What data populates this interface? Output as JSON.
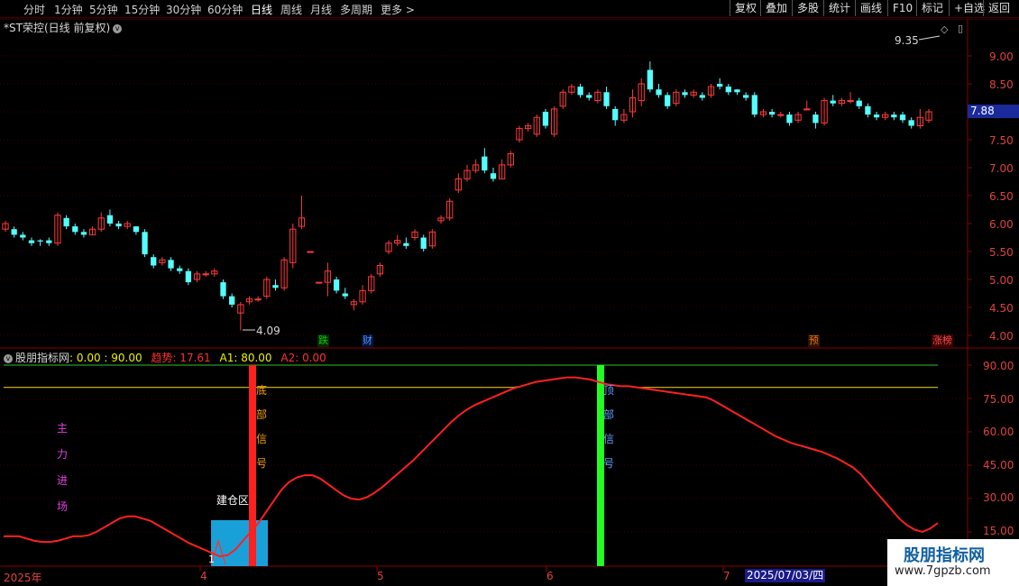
{
  "toolbar": {
    "periods": [
      "分时",
      "1分钟",
      "5分钟",
      "15分钟",
      "30分钟",
      "60分钟",
      "日线",
      "周线",
      "月线",
      "多周期",
      "更多 >"
    ],
    "active_period": "日线",
    "right_buttons": [
      "复权",
      "叠加",
      "多股",
      "统计",
      "画线",
      "F10",
      "标记",
      "+自选",
      "返回"
    ]
  },
  "main_chart": {
    "title": "*ST荣控(日线 前复权)",
    "title_circle": "v",
    "current_price": "7.88",
    "high_label": "9.35",
    "low_label": "4.09",
    "badges": [
      {
        "text": "跌",
        "color": "#00c000"
      },
      {
        "text": "财",
        "color": "#3a7aff"
      },
      {
        "text": "预",
        "color": "#e06000"
      },
      {
        "text": "涨榜",
        "color": "#e03030"
      }
    ],
    "y_ticks": [
      "9.00",
      "8.50",
      "8.00",
      "7.50",
      "7.00",
      "6.50",
      "6.00",
      "5.50",
      "5.00",
      "4.50",
      "4.00"
    ]
  },
  "indicator": {
    "name": "股朋指标网",
    "label_range": ": 0.00 : 90.00",
    "trend_label": "趋势: 17.61",
    "a1_label": "A1: 80.00",
    "a2_label": "A2: 0.00",
    "y_ticks": [
      "90.00",
      "75.00",
      "60.00",
      "45.00",
      "30.00",
      "15.00"
    ],
    "bottom_signal_text": [
      "底",
      "部",
      "信",
      "号"
    ],
    "top_signal_text": [
      "顶",
      "部",
      "信",
      "号"
    ],
    "main_force_text": [
      "主",
      "力",
      "进",
      "场"
    ],
    "build_zone_text": "建仓区",
    "marker_1": "1"
  },
  "x_axis": {
    "labels": [
      "2025年",
      "4",
      "5",
      "6",
      "7"
    ],
    "cursor_date": "2025/07/03/四"
  },
  "watermark": {
    "title": "股朋指标网",
    "url": "www.7gpzb.com"
  },
  "chart_data": {
    "type": "candlestick",
    "title": "*ST荣控(日线 前复权)",
    "ylim": [
      4.0,
      9.2
    ],
    "candles": [
      [
        5.9,
        6.0,
        5.85,
        6.05
      ],
      [
        5.9,
        5.8,
        5.75,
        5.95
      ],
      [
        5.8,
        5.75,
        5.7,
        5.85
      ],
      [
        5.7,
        5.65,
        5.6,
        5.75
      ],
      [
        5.7,
        5.68,
        5.6,
        5.72
      ],
      [
        5.7,
        5.65,
        5.6,
        5.75
      ],
      [
        5.65,
        6.15,
        5.6,
        6.2
      ],
      [
        6.1,
        5.95,
        5.9,
        6.15
      ],
      [
        5.95,
        5.85,
        5.8,
        6.0
      ],
      [
        5.85,
        5.8,
        5.75,
        5.9
      ],
      [
        5.8,
        5.9,
        5.8,
        5.95
      ],
      [
        5.9,
        6.1,
        5.85,
        6.2
      ],
      [
        6.15,
        6.0,
        5.95,
        6.25
      ],
      [
        6.0,
        5.95,
        5.9,
        6.05
      ],
      [
        5.95,
        6.0,
        5.9,
        6.05
      ],
      [
        5.95,
        5.85,
        5.8,
        5.95
      ],
      [
        5.85,
        5.45,
        5.4,
        5.9
      ],
      [
        5.4,
        5.25,
        5.2,
        5.45
      ],
      [
        5.3,
        5.35,
        5.25,
        5.4
      ],
      [
        5.35,
        5.2,
        5.15,
        5.4
      ],
      [
        5.2,
        5.15,
        5.1,
        5.25
      ],
      [
        5.15,
        4.95,
        4.9,
        5.2
      ],
      [
        5.0,
        5.1,
        4.95,
        5.15
      ],
      [
        5.1,
        5.1,
        5.05,
        5.15
      ],
      [
        5.1,
        5.15,
        5.05,
        5.2
      ],
      [
        4.95,
        4.7,
        4.65,
        5.0
      ],
      [
        4.7,
        4.55,
        4.5,
        4.75
      ],
      [
        4.4,
        4.55,
        4.09,
        4.6
      ],
      [
        4.6,
        4.65,
        4.55,
        4.7
      ],
      [
        4.65,
        4.65,
        4.6,
        4.7
      ],
      [
        4.7,
        5.0,
        4.65,
        5.05
      ],
      [
        4.9,
        4.85,
        4.8,
        5.0
      ],
      [
        4.85,
        5.35,
        4.8,
        5.4
      ],
      [
        5.3,
        5.9,
        5.2,
        6.0
      ],
      [
        5.95,
        6.1,
        5.9,
        6.5
      ],
      [
        5.5,
        5.5,
        5.5,
        5.5
      ],
      [
        4.95,
        4.95,
        4.95,
        4.95
      ],
      [
        4.95,
        5.15,
        4.7,
        5.3
      ],
      [
        5.0,
        4.8,
        4.75,
        5.05
      ],
      [
        4.75,
        4.7,
        4.65,
        4.85
      ],
      [
        4.55,
        4.6,
        4.45,
        4.65
      ],
      [
        4.6,
        4.8,
        4.55,
        4.9
      ],
      [
        4.8,
        5.05,
        4.75,
        5.1
      ],
      [
        5.1,
        5.25,
        5.05,
        5.3
      ],
      [
        5.5,
        5.65,
        5.45,
        5.7
      ],
      [
        5.65,
        5.7,
        5.6,
        5.8
      ],
      [
        5.65,
        5.6,
        5.55,
        5.75
      ],
      [
        5.75,
        5.85,
        5.7,
        5.9
      ],
      [
        5.75,
        5.55,
        5.5,
        5.8
      ],
      [
        5.6,
        5.85,
        5.55,
        5.9
      ],
      [
        6.05,
        6.1,
        6.0,
        6.15
      ],
      [
        6.1,
        6.4,
        6.05,
        6.45
      ],
      [
        6.6,
        6.8,
        6.55,
        6.9
      ],
      [
        6.8,
        6.95,
        6.75,
        7.05
      ],
      [
        6.95,
        7.05,
        6.9,
        7.15
      ],
      [
        7.2,
        6.95,
        6.9,
        7.35
      ],
      [
        6.9,
        6.8,
        6.75,
        7.0
      ],
      [
        6.8,
        7.05,
        6.8,
        7.15
      ],
      [
        7.05,
        7.25,
        7.0,
        7.3
      ],
      [
        7.5,
        7.7,
        7.45,
        7.75
      ],
      [
        7.7,
        7.75,
        7.65,
        7.8
      ],
      [
        7.6,
        7.9,
        7.55,
        7.95
      ],
      [
        8.0,
        7.75,
        7.7,
        8.05
      ],
      [
        7.6,
        8.05,
        7.55,
        8.1
      ],
      [
        8.1,
        8.35,
        8.05,
        8.4
      ],
      [
        8.35,
        8.45,
        8.3,
        8.5
      ],
      [
        8.45,
        8.3,
        8.25,
        8.5
      ],
      [
        8.3,
        8.25,
        8.2,
        8.35
      ],
      [
        8.2,
        8.35,
        8.15,
        8.4
      ],
      [
        8.35,
        8.1,
        8.05,
        8.45
      ],
      [
        8.05,
        7.85,
        7.75,
        8.1
      ],
      [
        7.85,
        7.95,
        7.8,
        8.05
      ],
      [
        8.0,
        8.25,
        7.9,
        8.4
      ],
      [
        8.2,
        8.5,
        8.1,
        8.6
      ],
      [
        8.75,
        8.4,
        8.35,
        8.9
      ],
      [
        8.4,
        8.3,
        8.25,
        8.5
      ],
      [
        8.3,
        8.1,
        8.05,
        8.35
      ],
      [
        8.15,
        8.35,
        8.1,
        8.4
      ],
      [
        8.35,
        8.3,
        8.25,
        8.4
      ],
      [
        8.3,
        8.35,
        8.25,
        8.4
      ],
      [
        8.3,
        8.25,
        8.2,
        8.35
      ],
      [
        8.3,
        8.45,
        8.25,
        8.5
      ],
      [
        8.5,
        8.45,
        8.4,
        8.6
      ],
      [
        8.45,
        8.35,
        8.3,
        8.5
      ],
      [
        8.4,
        8.35,
        8.3,
        8.4
      ],
      [
        8.3,
        8.25,
        8.2,
        8.35
      ],
      [
        8.3,
        7.95,
        7.9,
        8.35
      ],
      [
        7.95,
        8.0,
        7.9,
        8.05
      ],
      [
        8.0,
        7.95,
        7.9,
        8.05
      ],
      [
        7.95,
        7.95,
        7.9,
        8.0
      ],
      [
        7.95,
        7.8,
        7.75,
        8.0
      ],
      [
        7.85,
        7.95,
        7.8,
        8.0
      ],
      [
        8.05,
        8.05,
        8.05,
        8.2
      ],
      [
        7.95,
        7.8,
        7.7,
        8.0
      ],
      [
        7.8,
        8.2,
        7.75,
        8.25
      ],
      [
        8.2,
        8.15,
        8.1,
        8.3
      ],
      [
        8.15,
        8.2,
        8.1,
        8.25
      ],
      [
        8.2,
        8.2,
        8.15,
        8.35
      ],
      [
        8.2,
        8.1,
        8.05,
        8.25
      ],
      [
        8.1,
        7.95,
        7.9,
        8.15
      ],
      [
        7.95,
        7.9,
        7.85,
        8.0
      ],
      [
        7.9,
        7.95,
        7.85,
        8.0
      ],
      [
        7.95,
        7.9,
        7.85,
        8.0
      ],
      [
        7.95,
        7.85,
        7.8,
        8.0
      ],
      [
        7.85,
        7.75,
        7.7,
        7.9
      ],
      [
        7.75,
        7.9,
        7.7,
        8.05
      ],
      [
        7.85,
        8.0,
        7.8,
        8.05
      ]
    ],
    "indicator": {
      "ylim": [
        5,
        95
      ],
      "trend": [
        13,
        13,
        13,
        12,
        11,
        10.5,
        10.5,
        11,
        12,
        13,
        13,
        13.5,
        15,
        17,
        19,
        21,
        22,
        22,
        21,
        20,
        18,
        16,
        14,
        12,
        10,
        8.5,
        7,
        5.5,
        4,
        4.5,
        7,
        11,
        15,
        19,
        24,
        29,
        34,
        37.5,
        39.5,
        40.5,
        40.5,
        39,
        36.5,
        34,
        31.5,
        30,
        29.5,
        30.5,
        32.5,
        35,
        38,
        41,
        44,
        47,
        50.5,
        54,
        57.5,
        61,
        64.5,
        67.5,
        70,
        72,
        73.5,
        75,
        76.5,
        78,
        79.5,
        80.5,
        81.5,
        82.5,
        83,
        83.5,
        84,
        84.5,
        84.5,
        84,
        83.5,
        82.5,
        81.5,
        81,
        80.5,
        80.5,
        80,
        79.5,
        79,
        78.5,
        78,
        77.5,
        77,
        76.5,
        76,
        75.5,
        74,
        72,
        70,
        68,
        66,
        64,
        62,
        60,
        58,
        56.5,
        55,
        54,
        53,
        52,
        51,
        49.5,
        48,
        46,
        44,
        41,
        37,
        33,
        29,
        25,
        21,
        18,
        16,
        15,
        16.5,
        19
      ],
      "a1": 80,
      "a2": 0,
      "upper_line": 90
    }
  }
}
